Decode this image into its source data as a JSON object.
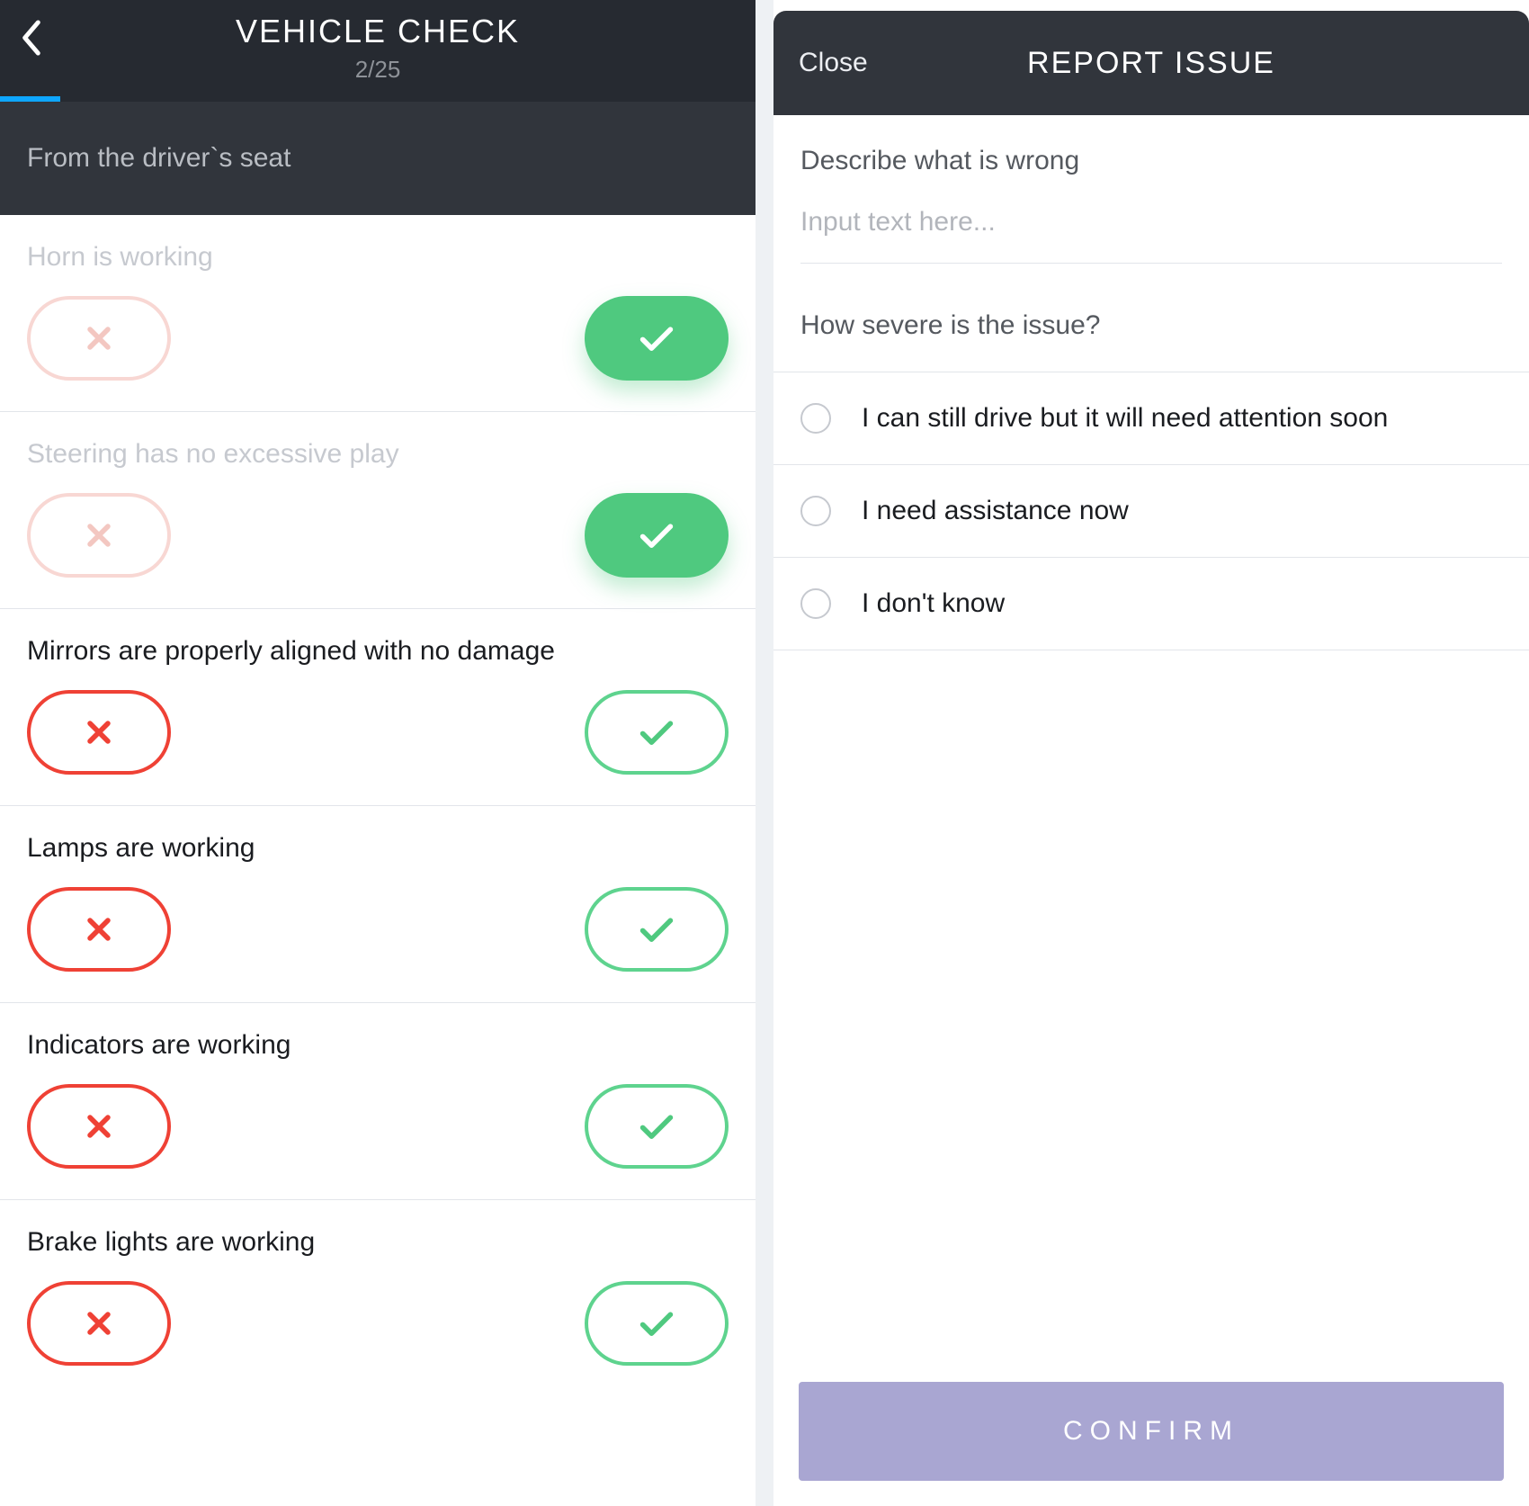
{
  "vehicle_check": {
    "title": "VEHICLE CHECK",
    "progress_label": "2/25",
    "section_title": "From the driver`s seat",
    "items": [
      {
        "question": "Horn is working",
        "answered": true
      },
      {
        "question": "Steering has no excessive play",
        "answered": true
      },
      {
        "question": "Mirrors are properly aligned with no damage",
        "answered": false
      },
      {
        "question": "Lamps are working",
        "answered": false
      },
      {
        "question": "Indicators are working",
        "answered": false
      },
      {
        "question": "Brake lights are working",
        "answered": false
      }
    ]
  },
  "report_issue": {
    "close_label": "Close",
    "title": "REPORT ISSUE",
    "describe_label": "Describe what is wrong",
    "input_placeholder": "Input text here...",
    "severity_label": "How severe is the issue?",
    "options": [
      "I can still drive but it will need attention soon",
      "I need assistance now",
      "I don't know"
    ],
    "confirm_label": "CONFIRM"
  }
}
